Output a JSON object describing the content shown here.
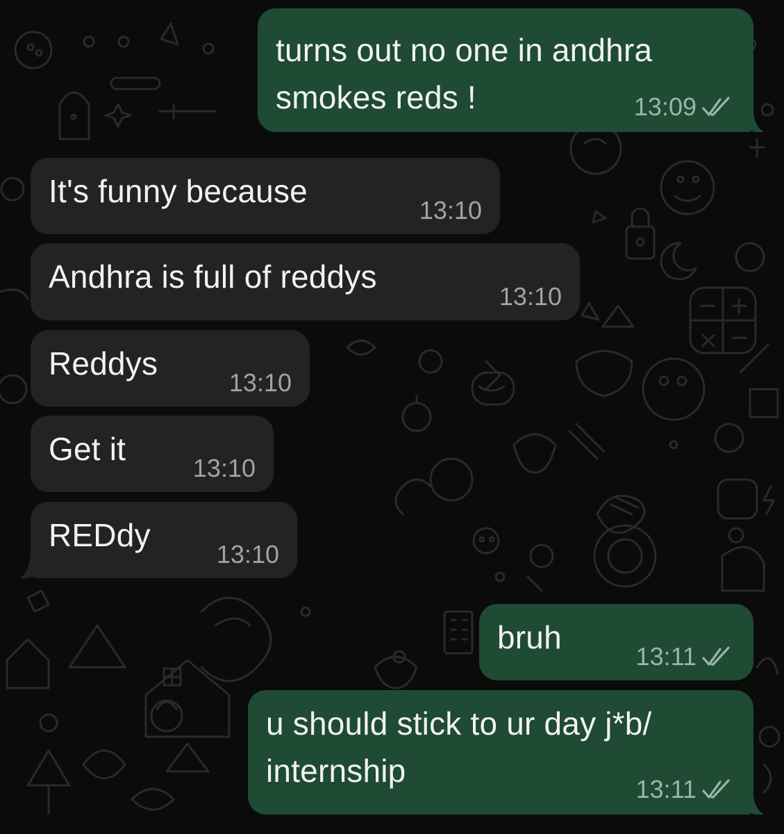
{
  "colors": {
    "background": "#0b0b0b",
    "outgoing_bubble": "#1f4a33",
    "incoming_bubble": "#232323",
    "text": "#f2f2f2",
    "outgoing_meta": "#9bb5a6",
    "incoming_meta": "#a3a3a3"
  },
  "messages": [
    {
      "direction": "outgoing",
      "lines": [
        "turns out no one in andhra",
        "smokes reds !"
      ],
      "time": "13:09",
      "status": "read-ticks-icon"
    },
    {
      "direction": "incoming",
      "lines": [
        "It's funny because"
      ],
      "time": "13:10"
    },
    {
      "direction": "incoming",
      "lines": [
        "Andhra is full of reddys"
      ],
      "time": "13:10"
    },
    {
      "direction": "incoming",
      "lines": [
        "Reddys"
      ],
      "time": "13:10"
    },
    {
      "direction": "incoming",
      "lines": [
        "Get it"
      ],
      "time": "13:10"
    },
    {
      "direction": "incoming",
      "lines": [
        "REDdy"
      ],
      "time": "13:10"
    },
    {
      "direction": "outgoing",
      "lines": [
        "bruh"
      ],
      "time": "13:11",
      "status": "read-ticks-icon"
    },
    {
      "direction": "outgoing",
      "lines": [
        "u should stick to ur day j*b/",
        "internship"
      ],
      "time": "13:11",
      "status": "read-ticks-icon"
    }
  ]
}
